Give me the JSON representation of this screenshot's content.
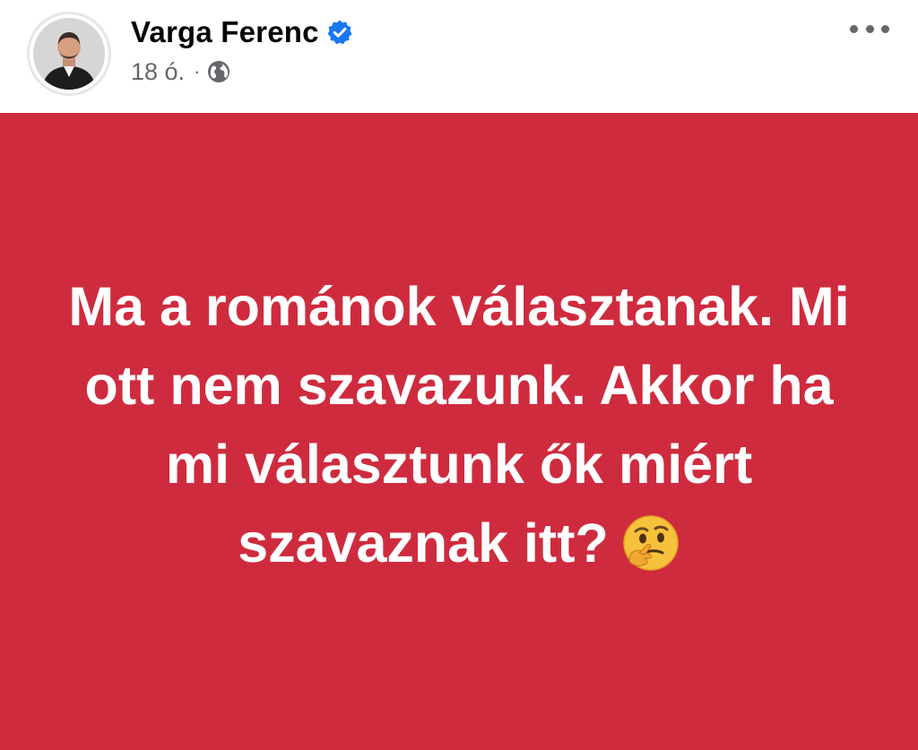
{
  "post": {
    "author": "Varga Ferenc",
    "timestamp": "18 ó.",
    "separator": "·",
    "privacy_icon": "globe-icon",
    "verified_icon": "verified-badge-icon",
    "more_icon": "more-options-icon",
    "body_text": "Ma a románok választanak. Mi ott nem szavazunk. Akkor ha mi választunk ők miért szavaznak itt?",
    "emoji": "thinking-face-emoji",
    "background_color": "#cf2b3e",
    "text_color": "#ffffff"
  }
}
